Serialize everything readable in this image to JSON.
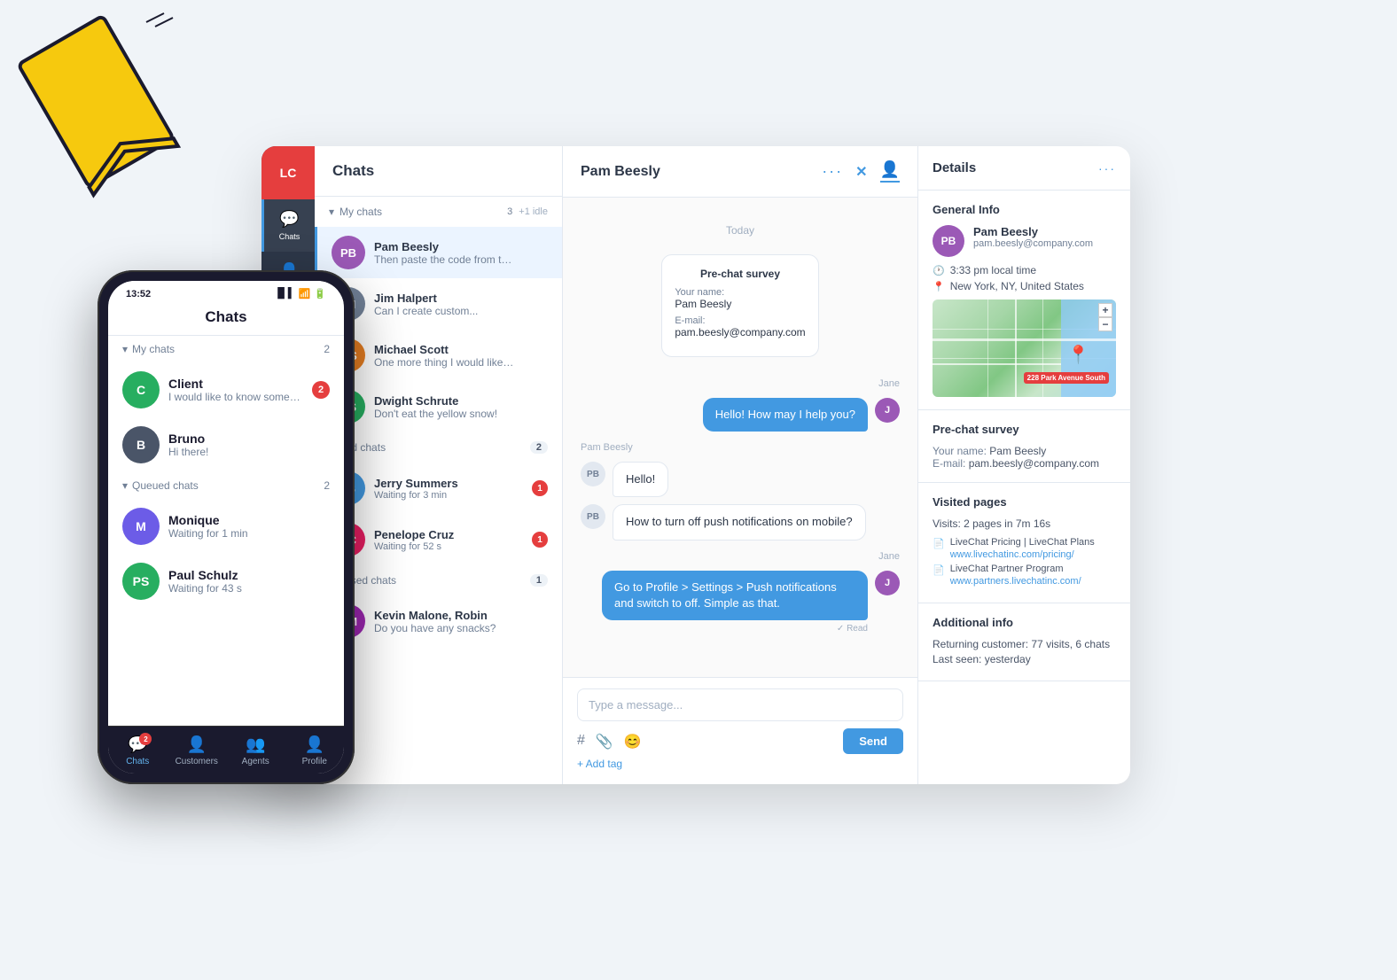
{
  "brand": {
    "logo_text": "LC",
    "accent_color": "#4299e1",
    "danger_color": "#e53e3e"
  },
  "bookmark": {
    "decoration": "yellow bookmark icon"
  },
  "desktop": {
    "sidebar": {
      "items": [
        {
          "label": "Chats",
          "icon": "💬",
          "active": true
        },
        {
          "label": "Customers",
          "icon": "👤",
          "active": false
        }
      ]
    },
    "chats_panel": {
      "title": "Chats",
      "my_chats": {
        "label": "My chats",
        "count": "3",
        "idle_count": "+1 idle",
        "items": [
          {
            "name": "Pam Beesly",
            "preview": "Then paste the code from the e...",
            "avatar_color": "#9b59b6",
            "initials": "PB",
            "active": true
          },
          {
            "name": "Jim Halpert",
            "preview": "Can I create custom...",
            "avatar_color": "#718096",
            "initials": "JH"
          },
          {
            "name": "Michael Scott",
            "preview": "One more thing I would like to a...",
            "avatar_color": "#e67e22",
            "initials": "MS"
          },
          {
            "name": "Dwight Schrute",
            "preview": "Don't eat the yellow snow!",
            "avatar_color": "#27ae60",
            "initials": "DS"
          }
        ]
      },
      "queued_chats": {
        "label": "ued chats",
        "count": "2",
        "items": [
          {
            "name": "Jerry Summers",
            "preview": "Waiting for 3 min",
            "badge": "1",
            "avatar_color": "#4299e1",
            "initials": "JS"
          },
          {
            "name": "Penelope Cruz",
            "preview": "Waiting for 52 s",
            "badge": "1",
            "avatar_color": "#e91e63",
            "initials": "PC"
          }
        ]
      },
      "supervised_chats": {
        "label": "rvised chats",
        "count": "1",
        "items": [
          {
            "name": "Kevin Malone, Robin",
            "preview": "Do you have any snacks?",
            "avatar_color": "#9c27b0",
            "initials": "KM"
          }
        ]
      }
    },
    "chat_area": {
      "contact_name": "Pam Beesly",
      "date_label": "Today",
      "pre_chat_survey": {
        "title": "Pre-chat survey",
        "name_label": "Your name:",
        "name_value": "Pam Beesly",
        "email_label": "E-mail:",
        "email_value": "pam.beesly@company.com"
      },
      "messages": [
        {
          "sender": "Jane",
          "type": "agent",
          "text": "Hello! How may I help you?",
          "avatar": "J"
        },
        {
          "sender": "Pam Beesly",
          "type": "customer",
          "text": "Hello!"
        },
        {
          "sender": "Pam Beesly",
          "type": "customer",
          "text": "How to turn off push notifications on mobile?"
        },
        {
          "sender": "Jane",
          "type": "agent",
          "text": "Go to Profile > Settings > Push notifications and switch to off. Simple as that.",
          "read_status": "✓ Read",
          "avatar": "J"
        }
      ],
      "input_placeholder": "Type a message...",
      "send_label": "Send",
      "add_tag_label": "+ Add tag"
    },
    "details_panel": {
      "title": "Details",
      "general_info": {
        "title": "General Info",
        "name": "Pam Beesly",
        "email": "pam.beesly@company.com",
        "local_time": "3:33 pm local time",
        "location": "New York, NY, United States",
        "map_label": "228 Park Avenue South"
      },
      "pre_chat_survey": {
        "title": "Pre-chat survey",
        "name_label": "Your name:",
        "name_value": "Pam Beesly",
        "email_label": "E-mail:",
        "email_value": "pam.beesly@company.com"
      },
      "visited_pages": {
        "title": "Visited pages",
        "visits_text": "Visits: 2 pages in 7m 16s",
        "pages": [
          {
            "title": "LiveChat Pricing | LiveChat Plans",
            "url": "www.livechatinc.com/pricing/"
          },
          {
            "title": "LiveChat Partner Program",
            "url": "www.partners.livechatinc.com/"
          }
        ]
      },
      "additional_info": {
        "title": "Additional info",
        "returning_customer": "Returning customer: 77 visits, 6 chats",
        "last_seen": "Last seen: yesterday"
      }
    }
  },
  "mobile": {
    "status_bar": {
      "time": "13:52",
      "signal": "▐▌▌",
      "wifi": "wifi",
      "battery": "battery"
    },
    "title": "Chats",
    "my_chats": {
      "label": "My chats",
      "count": "2",
      "items": [
        {
          "name": "Client",
          "preview": "I would like to know something more abo...",
          "avatar_color": "#27ae60",
          "initials": "C",
          "badge": "2"
        },
        {
          "name": "Bruno",
          "preview": "Hi there!",
          "avatar_color": "#4a5568",
          "initials": "B"
        }
      ]
    },
    "queued_chats": {
      "label": "Queued chats",
      "count": "2",
      "items": [
        {
          "name": "Monique",
          "preview": "Waiting for 1 min",
          "avatar_color": "#6c5ce7",
          "initials": "M"
        },
        {
          "name": "Paul Schulz",
          "preview": "Waiting for 43 s",
          "avatar_color": "#27ae60",
          "initials": "PS"
        }
      ]
    },
    "bottom_nav": [
      {
        "label": "Chats",
        "icon": "💬",
        "active": true,
        "badge": "2"
      },
      {
        "label": "Customers",
        "icon": "👤",
        "active": false
      },
      {
        "label": "Agents",
        "icon": "👥",
        "active": false
      },
      {
        "label": "Profile",
        "icon": "👤",
        "active": false,
        "is_profile": true
      }
    ]
  }
}
